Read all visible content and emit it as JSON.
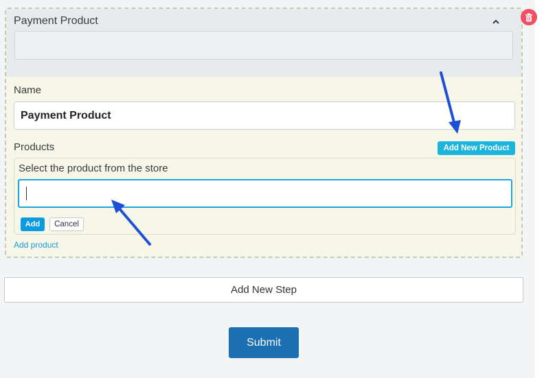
{
  "step": {
    "title": "Payment Product",
    "name_label": "Name",
    "name_value": "Payment Product",
    "products_label": "Products",
    "add_new_product_label": "Add New Product",
    "product_selector": {
      "hint": "Select the product from the store",
      "input_value": "",
      "add_label": "Add",
      "cancel_label": "Cancel"
    },
    "add_product_link": "Add product"
  },
  "add_new_step_label": "Add New Step",
  "submit_label": "Submit",
  "icons": {
    "collapse": "chevron-up-icon",
    "delete": "trash-icon"
  },
  "colors": {
    "accent": "#1bb4dc",
    "primary": "#1b6fb3",
    "danger": "#f05061",
    "annotation_arrow": "#1f4fd6"
  }
}
